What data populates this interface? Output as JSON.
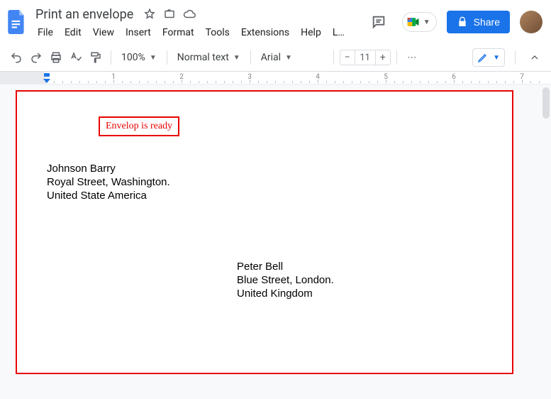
{
  "doc": {
    "title": "Print an envelope"
  },
  "menu": {
    "file": "File",
    "edit": "Edit",
    "view": "View",
    "insert": "Insert",
    "format": "Format",
    "tools": "Tools",
    "extensions": "Extensions",
    "help": "Help",
    "last": "L…"
  },
  "share": {
    "label": "Share"
  },
  "toolbar": {
    "zoom": "100%",
    "style": "Normal text",
    "font": "Arial",
    "font_size": "11",
    "more_symbol": "⋯"
  },
  "ruler": {
    "numbers": [
      "1",
      "2",
      "3",
      "4",
      "5",
      "6",
      "7"
    ]
  },
  "annotation": {
    "text": "Envelop is ready"
  },
  "from": {
    "name": "Johnson Barry",
    "street": "Royal Street, Washington.",
    "country": "United State America"
  },
  "to": {
    "name": "Peter Bell",
    "street": "Blue Street, London.",
    "country": "United Kingdom"
  }
}
